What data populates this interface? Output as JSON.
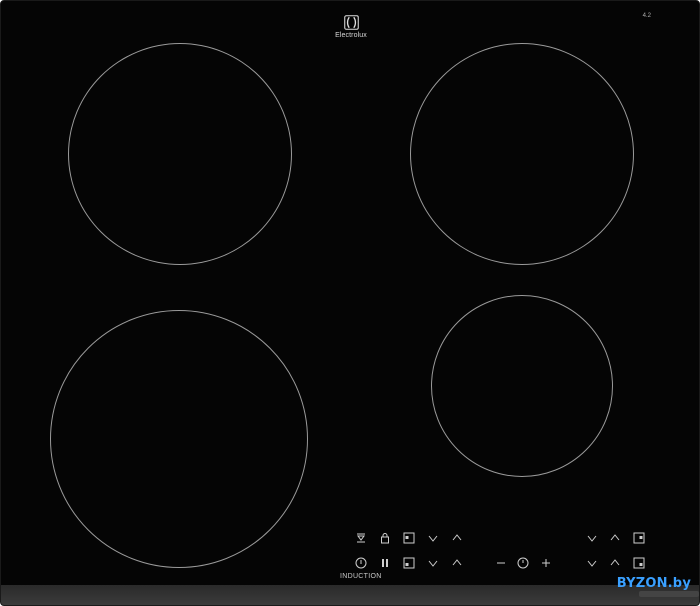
{
  "brand": {
    "name": "Electrolux",
    "icon": "electrolux-logo-icon"
  },
  "model_label": "4.2",
  "induction_label": "INDUCTION",
  "watermark": "BYZON.by",
  "controls": {
    "top_row": [
      "timer-icon",
      "lock-icon",
      "zone-select-icon",
      "chevron-down-icon",
      "chevron-up-icon"
    ],
    "bottom_row": [
      "power-icon",
      "pause-icon",
      "zone-select-icon",
      "chevron-down-icon",
      "chevron-up-icon"
    ],
    "center": [
      "minus-icon",
      "timer-icon",
      "plus-icon"
    ],
    "right_top": [
      "chevron-down-icon",
      "chevron-up-icon",
      "zone-select-icon"
    ],
    "right_bottom": [
      "chevron-down-icon",
      "chevron-up-icon",
      "zone-select-icon"
    ]
  },
  "colors": {
    "glass": "#050505",
    "zone_outline": "#9a9a9a",
    "controls": "#cfcfcf",
    "watermark": "#3aa0ff"
  }
}
